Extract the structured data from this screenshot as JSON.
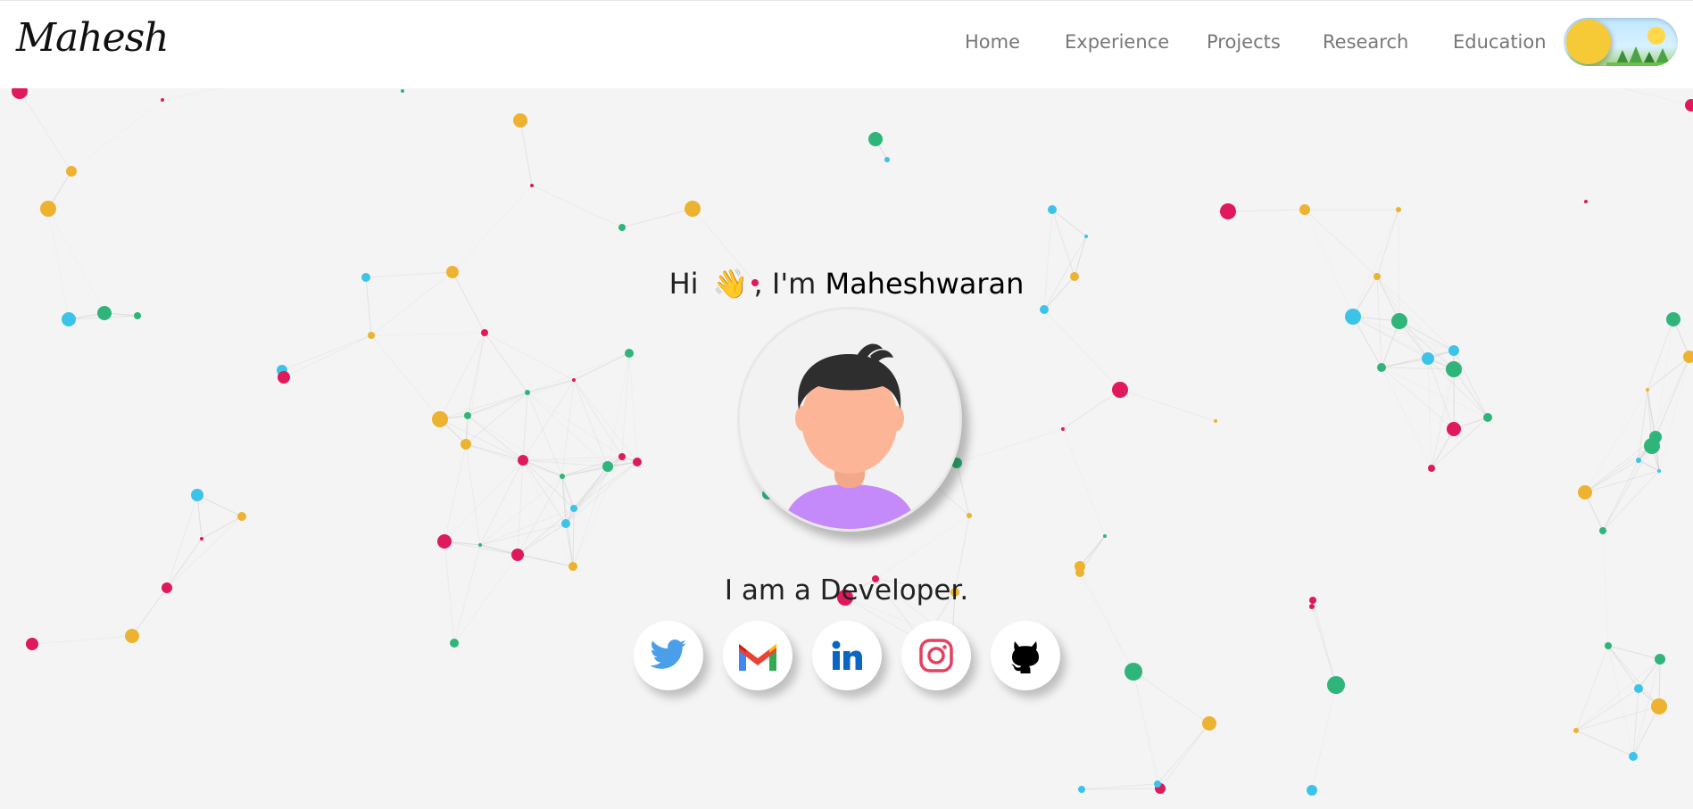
{
  "logo": {
    "text": "Mahesh"
  },
  "nav": {
    "items": [
      {
        "label": "Home"
      },
      {
        "label": "Experience"
      },
      {
        "label": "Projects"
      },
      {
        "label": "Research"
      },
      {
        "label": "Education"
      }
    ]
  },
  "theme_toggle": {
    "mode": "light",
    "icon": "sun-toggle-icon"
  },
  "hero": {
    "greeting_prefix": "Hi",
    "greeting_emoji": "👋",
    "greeting_mid": ", I'm",
    "name": "Maheshwaran",
    "tagline": "I am a Developer."
  },
  "socials": [
    {
      "name": "twitter",
      "icon": "twitter-icon",
      "color": "#4a9fe8"
    },
    {
      "name": "gmail",
      "icon": "gmail-icon",
      "color": "#ea4335"
    },
    {
      "name": "linkedin",
      "icon": "linkedin-icon",
      "color": "#0a66c2"
    },
    {
      "name": "instagram",
      "icon": "instagram-icon",
      "color": "#e4405f"
    },
    {
      "name": "github",
      "icon": "github-icon",
      "color": "#000000"
    }
  ],
  "colors": {
    "node_red": "#e0195b",
    "node_yellow": "#edb230",
    "node_green": "#2fb57a",
    "node_blue": "#3cc3ea",
    "avatar_shirt": "#c58af9",
    "avatar_skin": "#fcb597"
  }
}
